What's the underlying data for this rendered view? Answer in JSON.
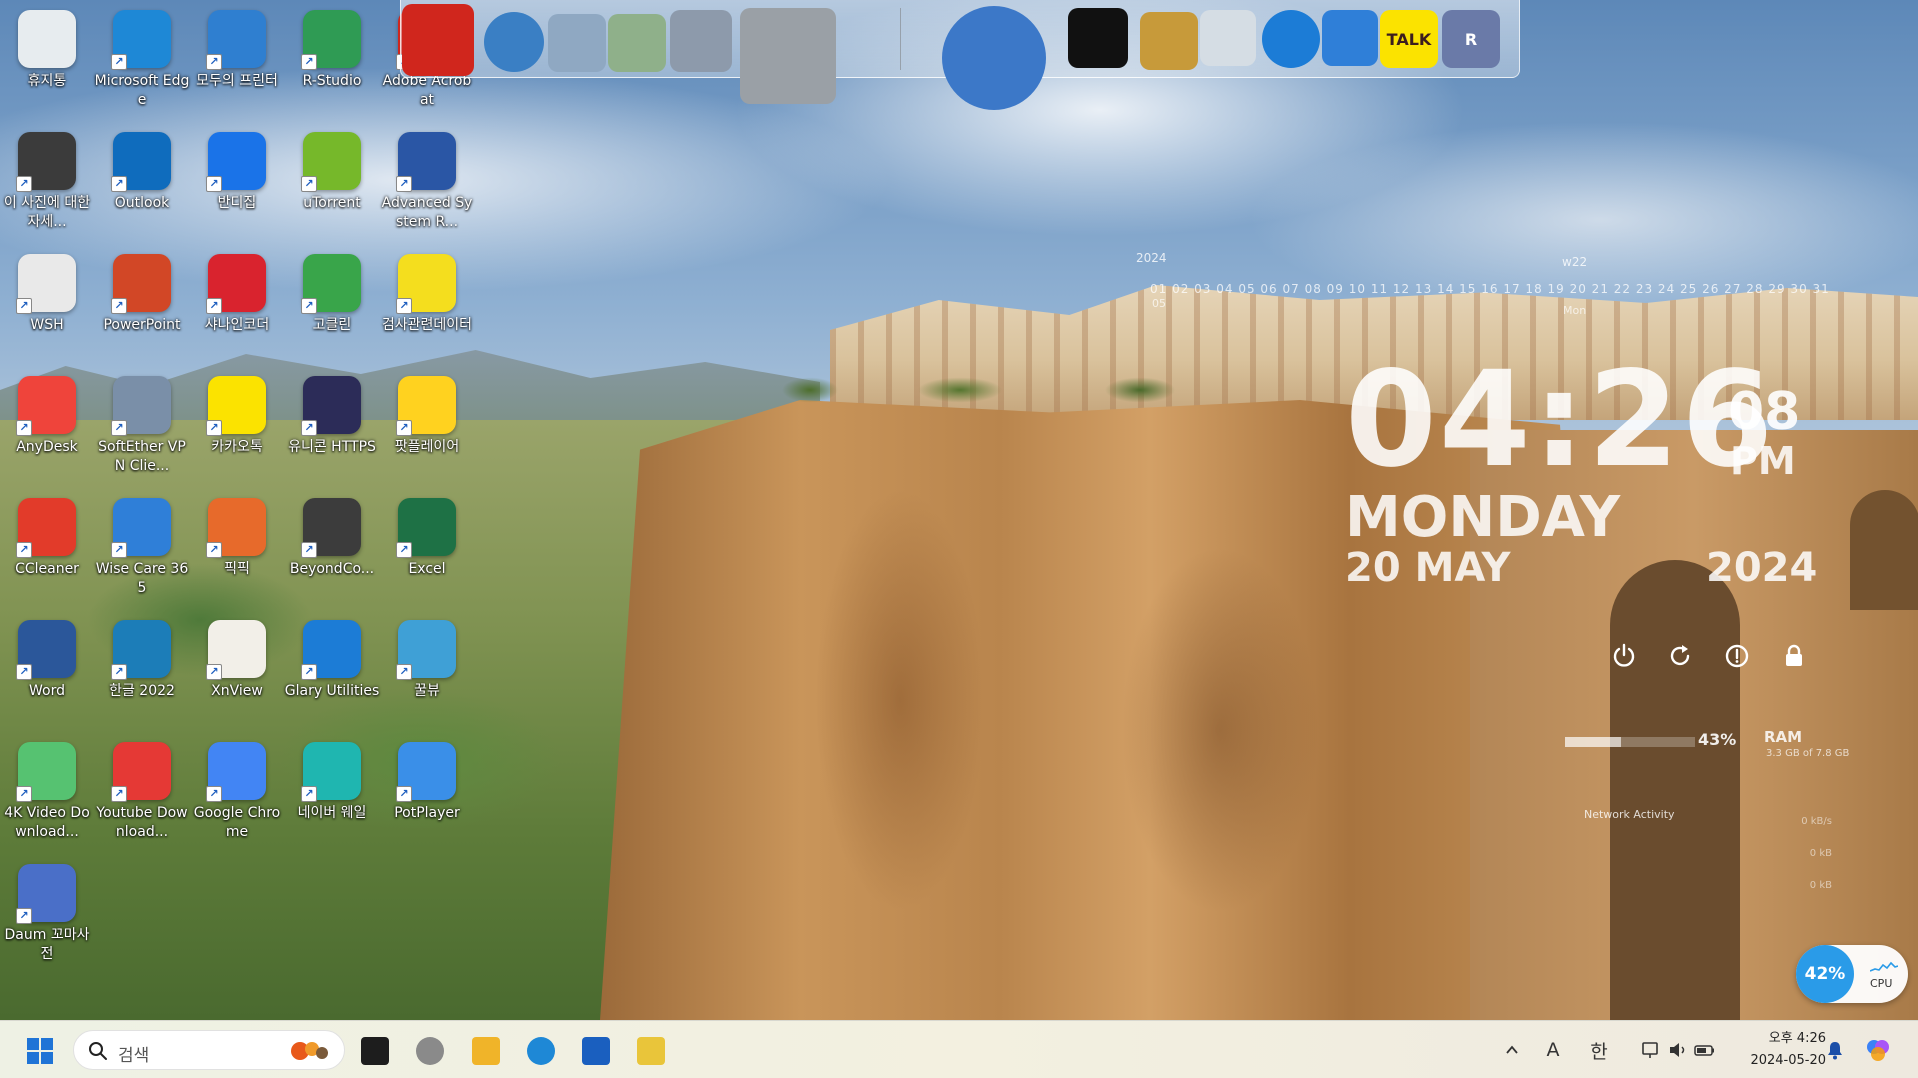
{
  "desktop": {
    "icons": [
      {
        "label": "휴지통",
        "icon": "recycle-bin-icon",
        "color": "#e7ecef"
      },
      {
        "label": "Microsoft Edge",
        "icon": "edge-icon",
        "color": "#1e88d6"
      },
      {
        "label": "모두의 프린터",
        "icon": "printer-icon",
        "color": "#2f7fd0"
      },
      {
        "label": "R-Studio",
        "icon": "r-studio-icon",
        "color": "#2f9b54"
      },
      {
        "label": "Adobe Acrobat",
        "icon": "acrobat-icon",
        "color": "#d0261d"
      },
      {
        "label": "이 사진에 대한 자세...",
        "icon": "photo-info-icon",
        "color": "#3b3b3b"
      },
      {
        "label": "Outlook",
        "icon": "outlook-icon",
        "color": "#0f6cbd"
      },
      {
        "label": "반디집",
        "icon": "bandizip-icon",
        "color": "#1a73e8"
      },
      {
        "label": "uTorrent",
        "icon": "utorrent-icon",
        "color": "#76b82a"
      },
      {
        "label": "Advanced System R...",
        "icon": "advanced-system-repair-icon",
        "color": "#2a56a5"
      },
      {
        "label": "WSH",
        "icon": "wsh-file-icon",
        "color": "#e9e9e9"
      },
      {
        "label": "PowerPoint",
        "icon": "powerpoint-icon",
        "color": "#d24726"
      },
      {
        "label": "샤나인코더",
        "icon": "shana-encoder-icon",
        "color": "#d9232e"
      },
      {
        "label": "고클린",
        "icon": "goclean-icon",
        "color": "#39a54a"
      },
      {
        "label": "검사관련데이터",
        "icon": "smiley-icon",
        "color": "#f4de1e"
      },
      {
        "label": "AnyDesk",
        "icon": "anydesk-icon",
        "color": "#ef443b"
      },
      {
        "label": "SoftEther VPN Clie...",
        "icon": "softether-vpn-icon",
        "color": "#7a8fa8"
      },
      {
        "label": "카카오톡",
        "icon": "kakaotalk-icon",
        "color": "#fbe300"
      },
      {
        "label": "유니콘 HTTPS",
        "icon": "unicorn-https-icon",
        "color": "#2c2c58"
      },
      {
        "label": "팟플레이어",
        "icon": "potplayer-yellow-icon",
        "color": "#ffd21f"
      },
      {
        "label": "CCleaner",
        "icon": "ccleaner-icon",
        "color": "#e23b2a"
      },
      {
        "label": "Wise Care 365",
        "icon": "wise-care-icon",
        "color": "#2f7fd8"
      },
      {
        "label": "픽픽",
        "icon": "picpick-icon",
        "color": "#e76a2b"
      },
      {
        "label": "BeyondCo...",
        "icon": "beyond-compare-icon",
        "color": "#3c3c3c"
      },
      {
        "label": "Excel",
        "icon": "excel-icon",
        "color": "#1e7145"
      },
      {
        "label": "Word",
        "icon": "word-icon",
        "color": "#2b579a"
      },
      {
        "label": "한글 2022",
        "icon": "hangul-icon",
        "color": "#1c7db8"
      },
      {
        "label": "XnView",
        "icon": "xnview-icon",
        "color": "#f2efe8"
      },
      {
        "label": "Glary Utilities",
        "icon": "glary-utilities-icon",
        "color": "#1c7cd6"
      },
      {
        "label": "꿀뷰",
        "icon": "honeyview-icon",
        "color": "#3fa0d6"
      },
      {
        "label": "4K Video Download...",
        "icon": "4k-video-downloader-icon",
        "color": "#56c271"
      },
      {
        "label": "Youtube Download...",
        "icon": "youtube-downloader-icon",
        "color": "#e53935"
      },
      {
        "label": "Google Chrome",
        "icon": "chrome-icon",
        "color": "#4285f4"
      },
      {
        "label": "네이버 웨일",
        "icon": "naver-whale-icon",
        "color": "#1fb6b0"
      },
      {
        "label": "PotPlayer",
        "icon": "potplayer-icon",
        "color": "#3a8fe8"
      },
      {
        "label": "Daum 꼬마사전",
        "icon": "daum-dictionary-icon",
        "color": "#4a6fc8"
      }
    ]
  },
  "dock": {
    "items": [
      {
        "icon": "acrobat-reader-icon",
        "color": "#d0261d",
        "text": ""
      },
      {
        "icon": "internet-globe-icon",
        "color": "#3a7fc4",
        "text": ""
      },
      {
        "icon": "folder-documents-icon",
        "color": "#8fa8c2",
        "text": ""
      },
      {
        "icon": "folder-green-icon",
        "color": "#8fb08a",
        "text": ""
      },
      {
        "icon": "folder-network-icon",
        "color": "#8d9aab",
        "text": ""
      },
      {
        "icon": "system-tools-icon",
        "color": "#9aa0a6",
        "text": ""
      },
      {
        "icon": "globe-icon",
        "color": "#3c78c8",
        "text": ""
      },
      {
        "icon": "tshirt-icon",
        "color": "#111111",
        "text": ""
      },
      {
        "icon": "hammer-icon",
        "color": "#c79a3a",
        "text": ""
      },
      {
        "icon": "recycle-bin-icon",
        "color": "#d5dde4",
        "text": ""
      },
      {
        "icon": "glary-utilities-icon",
        "color": "#1c7cd6",
        "text": ""
      },
      {
        "icon": "wise-care-icon",
        "color": "#2f7fd8",
        "text": ""
      },
      {
        "icon": "kakaotalk-icon",
        "color": "#fbe300",
        "text": "TALK"
      },
      {
        "icon": "registry-icon",
        "color": "#6a7aa8",
        "text": "R"
      }
    ]
  },
  "calendar": {
    "year": "2024",
    "week": "w22",
    "month": "05",
    "weekday_short": "Mon",
    "days": "01 02 03 04 05 06 07 08 09 10 11 12 13 14 15 16 17 18 19 20 21 22 23 24 25 26 27 28 29 30 31"
  },
  "clock": {
    "time": "04:26",
    "seconds": "08",
    "ampm": "PM",
    "weekday": "MONDAY",
    "date": "20 MAY",
    "year": "2024"
  },
  "system_widget": {
    "buttons": [
      {
        "icon": "power-icon"
      },
      {
        "icon": "restart-icon"
      },
      {
        "icon": "hibernate-icon"
      },
      {
        "icon": "lock-icon"
      }
    ],
    "ram_percent": "43%",
    "ram_fraction": 0.43,
    "ram_label": "RAM",
    "ram_detail": "3.3 GB of 7.8 GB",
    "network_label": "Network Activity",
    "network_stats": [
      "0 kB/s",
      "0 kB",
      "0 kB"
    ],
    "cpu_percent": "42%",
    "cpu_label": "CPU"
  },
  "taskbar": {
    "start_icon": "windows-start-icon",
    "search_placeholder": "검색",
    "apps": [
      {
        "icon": "task-view-icon"
      },
      {
        "icon": "copilot-icon"
      },
      {
        "icon": "file-explorer-icon"
      },
      {
        "icon": "edge-icon"
      },
      {
        "icon": "microsoft-store-icon"
      },
      {
        "icon": "r-studio-taskbar-icon"
      }
    ],
    "tray": {
      "chevron": "^",
      "ime_mode": "A",
      "ime_lang": "한",
      "time": "오후 4:26",
      "date": "2024-05-20"
    }
  }
}
